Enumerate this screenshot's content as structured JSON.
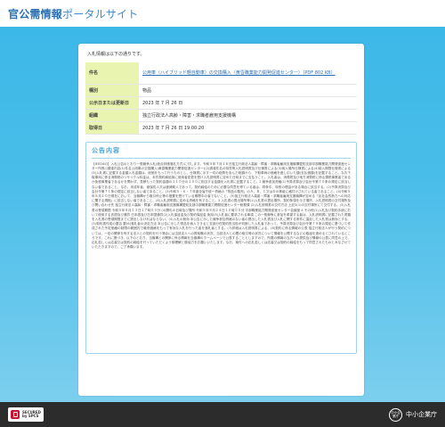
{
  "header": {
    "title_main": "官公需情報",
    "title_sub": "ポータルサイト"
  },
  "intro": "入札情報は以下の通りです。",
  "info": [
    {
      "label": "件名",
      "value": "公用車（ハイブリッド軽自動車）の交換購入（黄昏職業能力開発促進センター）（PDF 802 KB）",
      "is_link": true
    },
    {
      "label": "種別",
      "value": "物品",
      "is_link": false
    },
    {
      "label": "公示日または更新日",
      "value": "2023 年 7 月 26 日",
      "is_link": false
    },
    {
      "label": "組織",
      "value": "独立行政法人高齢・障害・求職者雇用支援機構",
      "is_link": false
    },
    {
      "label": "取得日",
      "value": "2023 年 7 月 26 日 19:00:20",
      "is_link": false
    }
  ],
  "notice": {
    "title": "公告内容",
    "body": "【JEED4の】入札公告のとおり一般競争入札(総合評価落札方式)に付します。令和５年７月２６日独立行政法人高齢・障害・求職者雇用支援機構愛知支部中部職業能力開発促進センター所長◎調達内容(1)件名公用車の交換購入(黄昏職業能力開発促進センター)(2)調達件名の特質等入札説明書及び仕様書による(3)納入場所仕様書による(4)納入期限仕様書による(5)入札書に記載する金額入札金額は、総価をもって行うものとし、仕様書に示す一切の経費を含んだ総額から、下取車両の価格を差し引いた額(支払価額)を記載すること。なお下取車両に係る消費税のリサイクル料金は、本件契約締結後に使用者変更を受け入札説明書に定めた日時までに支払うこと。入札者は、消費税及び地方消費税に係る課税事業者であるか免税事業者であるかを問わず、見積もった契約金額の１１０分の１００に相当する金額を入札書に記載すること。2 競争参加資格(1)予算決算及び会計令第７０条の規定に該当しない者であること。なお、未成年者、被保佐人又は被補助人であって、契約締結のために必要な同意を得ている者は、同条中、特別の理由がある場合に該当する。(2)予算決算及び会計令第７１条の規定に該当しない者であること。(3)令和５・６・７年度全省庁統一資格の「物品の販売」のＡ、Ｂ、Ｃ又はＤの等級に格付けされている者であること。(4)令和５年８月１０日現在において、当機構から取引停止等の措置を受けている期間中の者でないこと。(5)独立行政法人高齢・障害・求職者雇用支援機構が定める「反社会的勢力への対応に関する規程」に該当しない者であること。(6)入札説明書に定める資格を有すること。3 入札書の提出場所等(1)入札書の提出場所、契約条項を示す場所、入札説明書の交付場所及び問い合わせ先 独立行政法人高齢・障害・求職者雇用支援機構愛知支部中部職業能力開発促進センター総務課 (2)入札説明書の交付方法 上記3(1)の交付場所にて交付する。(3)入札書の受領期限 令和５年８月２３日１７時００分 (4)開札の日時及び場所 令和５年８月２４日１０時００分 中部職業能力開発促進センター会議室 4 その他(1)入札及び契約手続において使用する言語及び通貨 日本語及び日本国通貨(2)入札保証金及び契約保証金 免除(3)入札者に要求される事項 この一般競争に参加を希望する者は、入札説明書に記載された書類を入札書の受領期限までに提出しなければならない。(4)入札の無効 本公告に示した競争参加資格のない者の提出した入札書及び入札に関する条件に違反した入札書は無効とする。(5)契約書作成の要否 要(6)落札者の決定方法 本公告に示した物品を納入できると支部分任契約担当役が判断した入札者であって、予算決算及び会計令第７９条の規定に基づいて作成された予定価格の制限の範囲内で最低価格をもって有効な入札を行った者を落札者とする。(7)詳細は入札説明書による。(8)契約に係る情報の公表 独立行政法人が行う契約については、一定の関係を有する法人との契約を行う場合には当該法人への再就職の状況、当該法人との間の取引等の状況について情報を公開するなどの取組を進めるとされているところです。これに基づき、以下のとおり、当機構との関係に係る情報を当機構のホームページで公表することとしますので、所要の情報の当方への提供及び情報の公表に同意の上で、応札若しくは応募又は契約の締結を行っていただくよう御理解と御協力をお願いいたします。なお、案件への応札若しくは応募又は契約の締結をもって同意されたものとみなさせていただきますので、ご了承願います。"
  },
  "footer": {
    "secured_line1": "SECURED",
    "secured_line2": "by SPCS",
    "org_logo": "中小企業庁",
    "org_name": "中小企業庁"
  },
  "colors": {
    "accent": "#2a6fb5",
    "bg_top": "#3cb8e8",
    "label_bg": "#e9f4b0",
    "footer": "#2c2c2c"
  }
}
